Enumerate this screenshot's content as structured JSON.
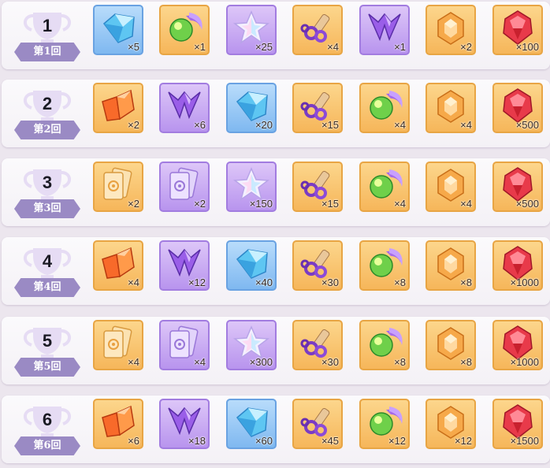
{
  "rows": [
    {
      "rank": "1",
      "label": "第1回",
      "items": [
        {
          "icon": "blue-crystal-icon",
          "rarity": "blue",
          "qty": "×5"
        },
        {
          "icon": "green-orb-icon",
          "rarity": "orange",
          "qty": "×1"
        },
        {
          "icon": "rainbow-star-icon",
          "rarity": "purple",
          "qty": "×25"
        },
        {
          "icon": "rope-scroll-icon",
          "rarity": "orange",
          "qty": "×4"
        },
        {
          "icon": "purple-shard-icon",
          "rarity": "purple",
          "qty": "×1"
        },
        {
          "icon": "amber-gem-icon",
          "rarity": "orange",
          "qty": "×2"
        },
        {
          "icon": "red-gem-icon",
          "rarity": "orange",
          "qty": "×100"
        }
      ]
    },
    {
      "rank": "2",
      "label": "第2回",
      "items": [
        {
          "icon": "orange-shard-icon",
          "rarity": "orange",
          "qty": "×2"
        },
        {
          "icon": "purple-shard-icon",
          "rarity": "purple",
          "qty": "×6"
        },
        {
          "icon": "blue-crystal-icon",
          "rarity": "blue",
          "qty": "×20"
        },
        {
          "icon": "rope-scroll-icon",
          "rarity": "orange",
          "qty": "×15"
        },
        {
          "icon": "green-orb-icon",
          "rarity": "orange",
          "qty": "×4"
        },
        {
          "icon": "amber-gem-icon",
          "rarity": "orange",
          "qty": "×4"
        },
        {
          "icon": "red-gem-icon",
          "rarity": "orange",
          "qty": "×500"
        }
      ]
    },
    {
      "rank": "3",
      "label": "第3回",
      "items": [
        {
          "icon": "orange-card-icon",
          "rarity": "orange",
          "qty": "×2"
        },
        {
          "icon": "purple-card-icon",
          "rarity": "purple",
          "qty": "×2"
        },
        {
          "icon": "rainbow-star-icon",
          "rarity": "purple",
          "qty": "×150"
        },
        {
          "icon": "rope-scroll-icon",
          "rarity": "orange",
          "qty": "×15"
        },
        {
          "icon": "green-orb-icon",
          "rarity": "orange",
          "qty": "×4"
        },
        {
          "icon": "amber-gem-icon",
          "rarity": "orange",
          "qty": "×4"
        },
        {
          "icon": "red-gem-icon",
          "rarity": "orange",
          "qty": "×500"
        }
      ]
    },
    {
      "rank": "4",
      "label": "第4回",
      "items": [
        {
          "icon": "orange-shard-icon",
          "rarity": "orange",
          "qty": "×4"
        },
        {
          "icon": "purple-shard-icon",
          "rarity": "purple",
          "qty": "×12"
        },
        {
          "icon": "blue-crystal-icon",
          "rarity": "blue",
          "qty": "×40"
        },
        {
          "icon": "rope-scroll-icon",
          "rarity": "orange",
          "qty": "×30"
        },
        {
          "icon": "green-orb-icon",
          "rarity": "orange",
          "qty": "×8"
        },
        {
          "icon": "amber-gem-icon",
          "rarity": "orange",
          "qty": "×8"
        },
        {
          "icon": "red-gem-icon",
          "rarity": "orange",
          "qty": "×1000"
        }
      ]
    },
    {
      "rank": "5",
      "label": "第5回",
      "items": [
        {
          "icon": "orange-card-icon",
          "rarity": "orange",
          "qty": "×4"
        },
        {
          "icon": "purple-card-icon",
          "rarity": "purple",
          "qty": "×4"
        },
        {
          "icon": "rainbow-star-icon",
          "rarity": "purple",
          "qty": "×300"
        },
        {
          "icon": "rope-scroll-icon",
          "rarity": "orange",
          "qty": "×30"
        },
        {
          "icon": "green-orb-icon",
          "rarity": "orange",
          "qty": "×8"
        },
        {
          "icon": "amber-gem-icon",
          "rarity": "orange",
          "qty": "×8"
        },
        {
          "icon": "red-gem-icon",
          "rarity": "orange",
          "qty": "×1000"
        }
      ]
    },
    {
      "rank": "6",
      "label": "第6回",
      "items": [
        {
          "icon": "orange-shard-icon",
          "rarity": "orange",
          "qty": "×6"
        },
        {
          "icon": "purple-shard-icon",
          "rarity": "purple",
          "qty": "×18"
        },
        {
          "icon": "blue-crystal-icon",
          "rarity": "blue",
          "qty": "×60"
        },
        {
          "icon": "rope-scroll-icon",
          "rarity": "orange",
          "qty": "×45"
        },
        {
          "icon": "green-orb-icon",
          "rarity": "orange",
          "qty": "×12"
        },
        {
          "icon": "amber-gem-icon",
          "rarity": "orange",
          "qty": "×12"
        },
        {
          "icon": "red-gem-icon",
          "rarity": "orange",
          "qty": "×1500"
        }
      ]
    }
  ]
}
